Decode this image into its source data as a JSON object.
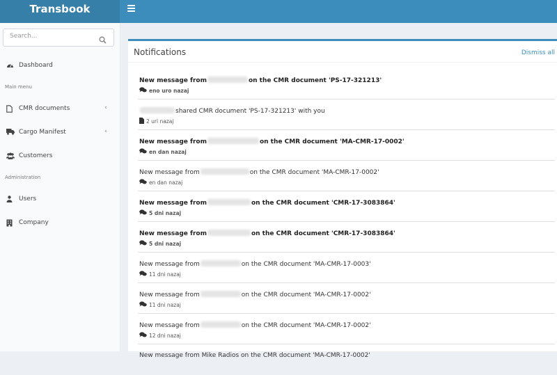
{
  "app": {
    "brand": "Transbook"
  },
  "search": {
    "placeholder": "Search..."
  },
  "sidebar": {
    "dashboard": "Dashboard",
    "main_menu_header": "Main menu",
    "cmr_documents": "CMR documents",
    "cargo_manifest": "Cargo Manifest",
    "customers": "Customers",
    "admin_header": "Administration",
    "users": "Users",
    "company": "Company"
  },
  "notifications": {
    "title": "Notifications",
    "dismiss_all": "Dismiss all",
    "items": [
      {
        "prefix": "New message from",
        "suffix": "on the CMR document 'PS-17-321213'",
        "time": "eno uro nazaj"
      },
      {
        "prefix": "",
        "suffix": "shared CMR document 'PS-17-321213' with you",
        "time": "2 uri nazaj"
      },
      {
        "prefix": "New message from",
        "suffix": "on the CMR document 'MA-CMR-17-0002'",
        "time": "en dan nazaj"
      },
      {
        "prefix": "New message from",
        "suffix": "on the CMR document 'MA-CMR-17-0002'",
        "time": "en dan nazaj"
      },
      {
        "prefix": "New message from",
        "suffix": "on the CMR document 'CMR-17-3083864'",
        "time": "5 dni nazaj"
      },
      {
        "prefix": "New message from",
        "suffix": "on the CMR document 'CMR-17-3083864'",
        "time": "5 dni nazaj"
      },
      {
        "prefix": "New message from",
        "suffix": "on the CMR document 'MA-CMR-17-0003'",
        "time": "11 dni nazaj"
      },
      {
        "prefix": "New message from",
        "suffix": "on the CMR document 'MA-CMR-17-0002'",
        "time": "11 dni nazaj"
      },
      {
        "prefix": "New message from",
        "suffix": "on the CMR document 'MA-CMR-17-0002'",
        "time": "12 dni nazaj"
      },
      {
        "prefix": "New message from Mike Radios on the CMR document 'MA-CMR-17-0002'",
        "suffix": "",
        "time": ""
      }
    ]
  }
}
